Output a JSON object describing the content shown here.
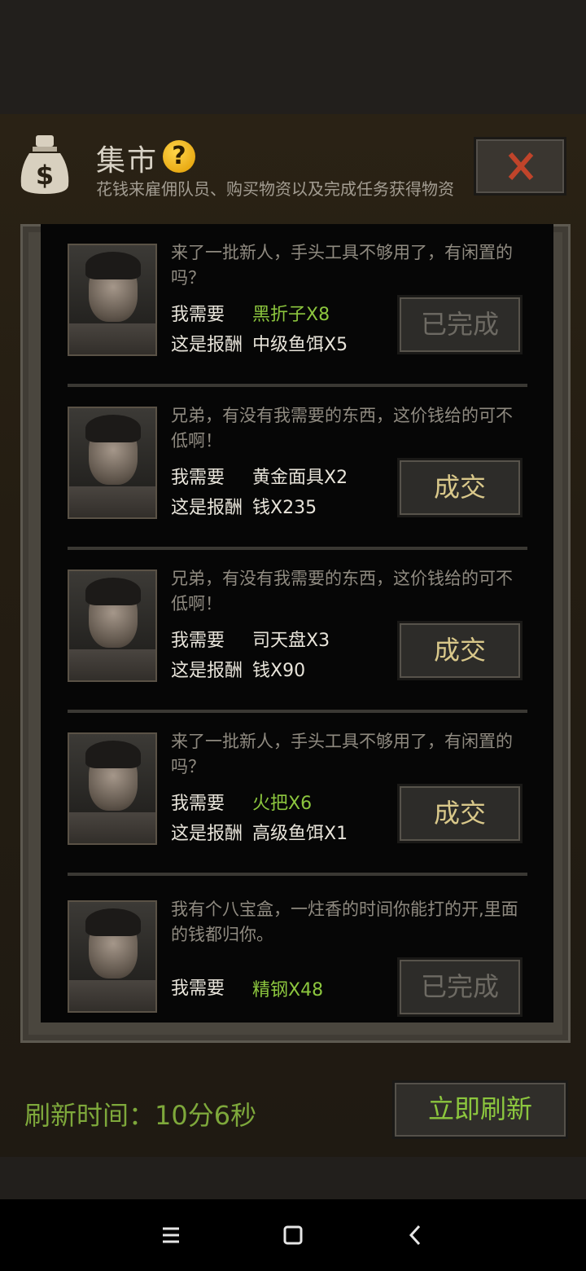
{
  "header": {
    "title": "集市",
    "help_symbol": "?",
    "subtitle": "花钱来雇佣队员、购买物资以及完成任务获得物资"
  },
  "labels": {
    "need": "我需要",
    "reward": "这是报酬"
  },
  "offers": [
    {
      "quote": "来了一批新人，手头工具不够用了，有闲置的吗？",
      "need": "黑折子X8",
      "reward": "中级鱼饵X5",
      "button": "已完成",
      "status": "completed"
    },
    {
      "quote": "兄弟，有没有我需要的东西，这价钱给的可不低啊！",
      "need": "黄金面具X2",
      "reward": "钱X235",
      "button": "成交",
      "status": "available"
    },
    {
      "quote": "兄弟，有没有我需要的东西，这价钱给的可不低啊！",
      "need": "司天盘X3",
      "reward": "钱X90",
      "button": "成交",
      "status": "available"
    },
    {
      "quote": "来了一批新人，手头工具不够用了，有闲置的吗？",
      "need": "火把X6",
      "reward": "高级鱼饵X1",
      "button": "成交",
      "status": "available"
    },
    {
      "quote": "我有个八宝盒，一炷香的时间你能打的开,里面的钱都归你。",
      "need": "精钢X48",
      "reward": "",
      "button": "已完成",
      "status": "completed"
    }
  ],
  "footer": {
    "refresh_label": "刷新时间：10分6秒",
    "refresh_button": "立即刷新"
  },
  "colors": {
    "accent_green": "#8cc63e",
    "button_gold": "#d9c88a"
  }
}
